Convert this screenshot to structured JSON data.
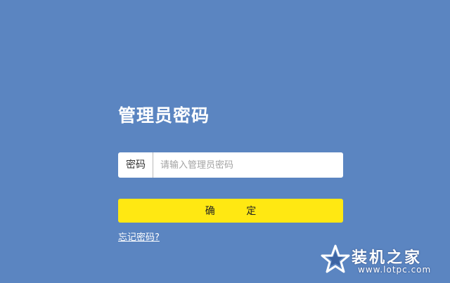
{
  "login": {
    "title": "管理员密码",
    "password_label": "密码",
    "password_value": "",
    "password_placeholder": "请输入管理员密码",
    "confirm_label": "确 定",
    "forgot_link": "忘记密码?"
  },
  "watermark": {
    "text": "装机之家",
    "url": "www.lotpc.com",
    "icon": "star-icon"
  },
  "colors": {
    "background": "#5b85c1",
    "button": "#ffe812",
    "text_on_background": "#ffffff"
  }
}
